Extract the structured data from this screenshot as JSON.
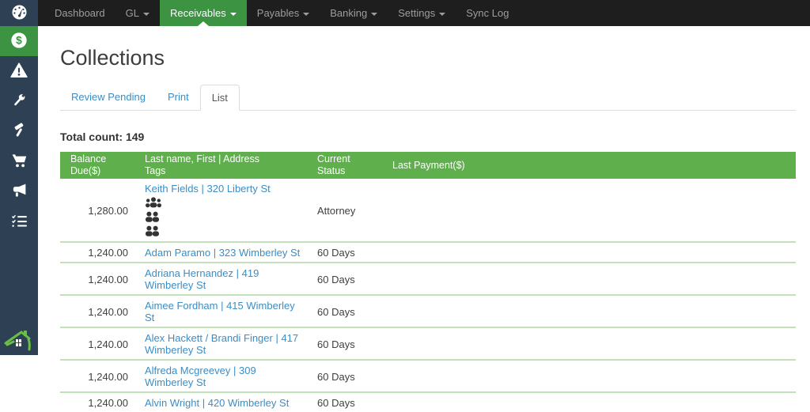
{
  "colors": {
    "accent_green": "#3c9342",
    "table_header_green": "#5fb04c",
    "row_divider_green": "#c2e0ba",
    "link_blue": "#3c8dc5",
    "sidebar_navy": "#2e4053",
    "navbar_black": "#1e1e1e",
    "logo_green": "#6abf4b"
  },
  "navbar": {
    "items": [
      {
        "label": "Dashboard",
        "caret": false,
        "active": false
      },
      {
        "label": "GL",
        "caret": true,
        "active": false
      },
      {
        "label": "Receivables",
        "caret": true,
        "active": true
      },
      {
        "label": "Payables",
        "caret": true,
        "active": false
      },
      {
        "label": "Banking",
        "caret": true,
        "active": false
      },
      {
        "label": "Settings",
        "caret": true,
        "active": false
      },
      {
        "label": "Sync Log",
        "caret": false,
        "active": false
      }
    ]
  },
  "sidebar": {
    "items": [
      {
        "icon": "dollar-icon",
        "active": true
      },
      {
        "icon": "warning-icon",
        "active": false
      },
      {
        "icon": "wrench-icon",
        "active": false
      },
      {
        "icon": "hammer-icon",
        "active": false
      },
      {
        "icon": "cart-icon",
        "active": false
      },
      {
        "icon": "megaphone-icon",
        "active": false
      },
      {
        "icon": "checklist-icon",
        "active": false
      }
    ]
  },
  "page": {
    "title": "Collections",
    "tabs": [
      {
        "label": "Review Pending",
        "active": false
      },
      {
        "label": "Print",
        "active": false
      },
      {
        "label": "List",
        "active": true
      }
    ],
    "total_count_label": "Total count:",
    "total_count_value": "149"
  },
  "table": {
    "headers": {
      "balance": "Balance Due($)",
      "name_line1": "Last name, First | Address",
      "name_line2": "Tags",
      "status": "Current Status",
      "last_payment": "Last Payment($)"
    },
    "rows": [
      {
        "balance": "1,280.00",
        "name": "Keith Fields | 320 Liberty St",
        "tag_icon_count": 3,
        "status": "Attorney",
        "last_payment": ""
      },
      {
        "balance": "1,240.00",
        "name": "Adam Paramo | 323 Wimberley St",
        "status": "60 Days",
        "last_payment": ""
      },
      {
        "balance": "1,240.00",
        "name": "Adriana Hernandez | 419 Wimberley St",
        "status": "60 Days",
        "last_payment": ""
      },
      {
        "balance": "1,240.00",
        "name": "Aimee Fordham | 415 Wimberley St",
        "status": "60 Days",
        "last_payment": ""
      },
      {
        "balance": "1,240.00",
        "name": "Alex Hackett / Brandi Finger | 417 Wimberley St",
        "status": "60 Days",
        "last_payment": ""
      },
      {
        "balance": "1,240.00",
        "name": "Alfreda Mcgreevey | 309 Wimberley St",
        "status": "60 Days",
        "last_payment": ""
      },
      {
        "balance": "1,240.00",
        "name": "Alvin Wright | 420 Wimberley St",
        "status": "60 Days",
        "last_payment": ""
      }
    ]
  }
}
